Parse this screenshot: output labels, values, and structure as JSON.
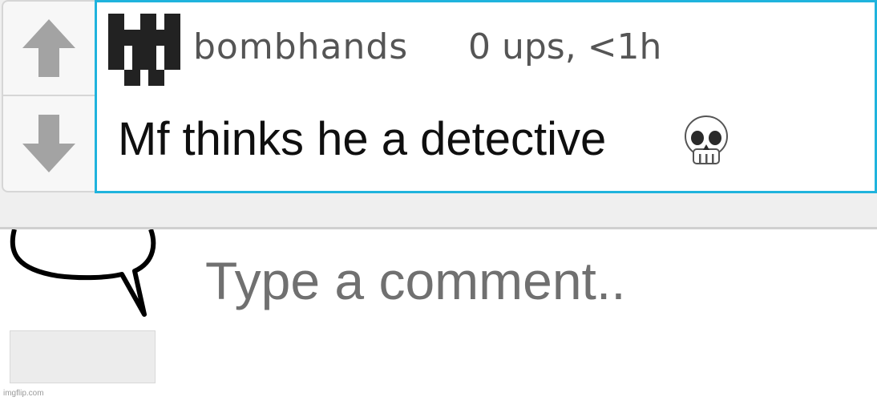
{
  "post": {
    "username": "bombhands",
    "meta": "0 ups, <1h",
    "text": "Mf thinks he a detective",
    "emoji_icon": "skull-emoji",
    "avatar_icon": "pixel-avatar-icon",
    "accent_color": "#1fb3dd"
  },
  "votes": {
    "up_icon": "upvote-arrow-icon",
    "down_icon": "downvote-arrow-icon"
  },
  "reply": {
    "placeholder": "Type a comment..",
    "attachment_icon": "speech-bubble-icon",
    "watermark": "imgflip.com"
  }
}
